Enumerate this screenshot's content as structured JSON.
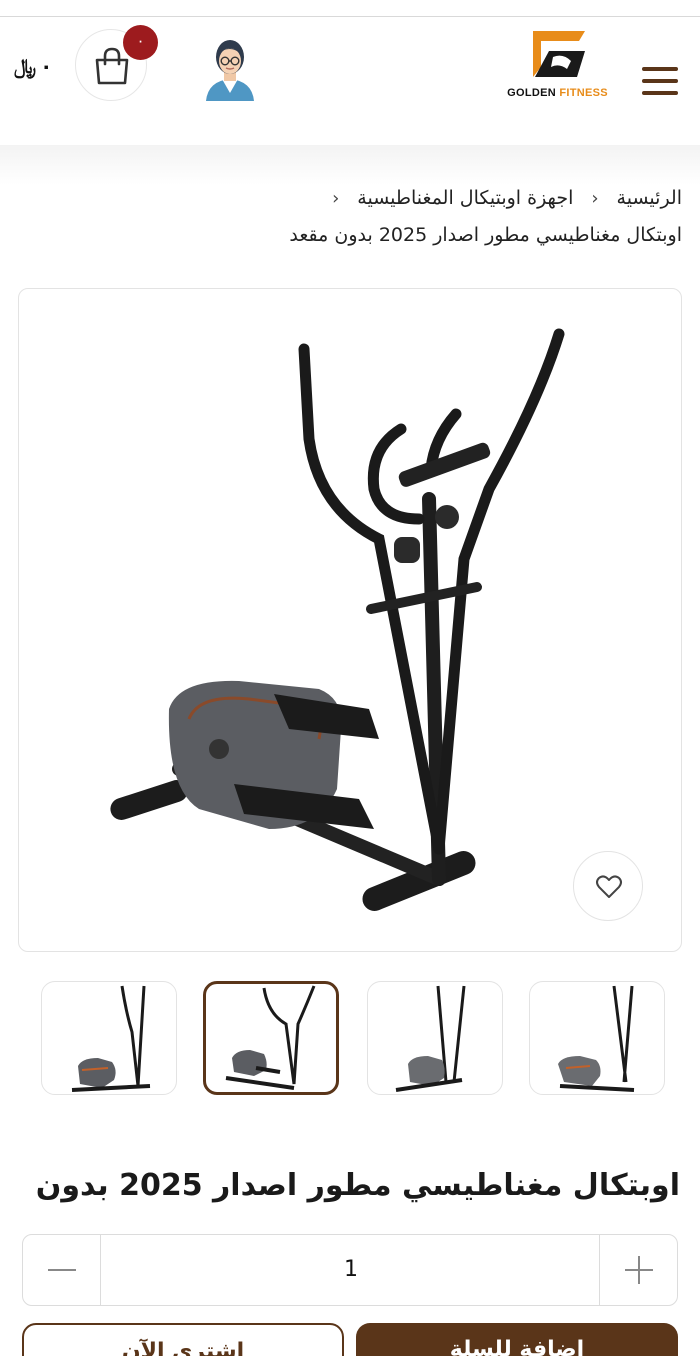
{
  "header": {
    "logo": {
      "word1": "GOLDEN",
      "word2": "FITNESS"
    },
    "cart": {
      "count": "٠",
      "total": "٠",
      "currency": "﷼"
    }
  },
  "breadcrumb": {
    "home": "الرئيسية",
    "category": "اجهزة اوبتيكال المغناطيسية",
    "current": "اوبتكال مغناطيسي مطور اصدار 2025 بدون مقعد"
  },
  "product": {
    "title": "اوبتكال مغناطيسي مطور اصدار 2025 بدون",
    "quantity": "1"
  },
  "thumbnails": {
    "count": 4,
    "active_index": 1
  },
  "actions": {
    "add_to_cart": "إضافة للسلة",
    "buy_now": "اشتري الآن"
  },
  "colors": {
    "brand_brown": "#5a3519",
    "accent_orange": "#e88c1a",
    "badge_red": "#9d1b1e"
  },
  "icons": [
    "menu-icon",
    "cart-icon",
    "avatar-icon",
    "heart-icon",
    "minus-icon",
    "plus-icon"
  ]
}
